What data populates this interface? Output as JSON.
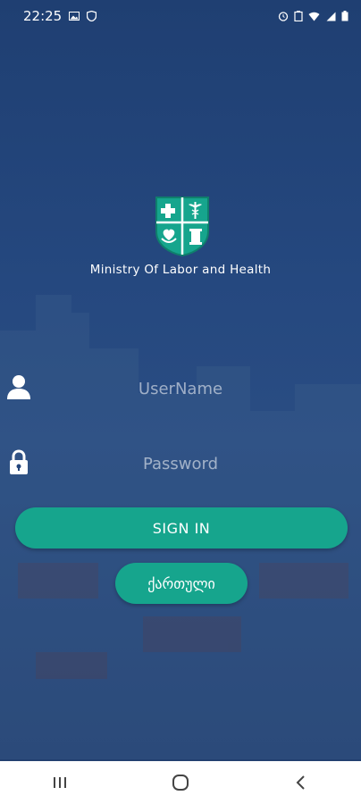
{
  "status_bar": {
    "time": "22:25",
    "left_icons": [
      "image-icon",
      "shield-icon"
    ],
    "right_icons": [
      "alarm-icon",
      "battery-saver-icon",
      "wifi-icon",
      "signal-icon",
      "battery-icon"
    ]
  },
  "brand": {
    "name": "Ministry Of Labor and Health",
    "logo_colors": {
      "teal": "#16a58d",
      "white": "#ffffff"
    }
  },
  "login": {
    "username_placeholder": "UserName",
    "password_placeholder": "Password",
    "sign_in_label": "SIGN IN",
    "language_label": "ქართული"
  },
  "nav": {
    "icons": [
      "recents-icon",
      "home-icon",
      "back-icon"
    ]
  },
  "colors": {
    "accent": "#16a58d",
    "background": "#24467c"
  }
}
